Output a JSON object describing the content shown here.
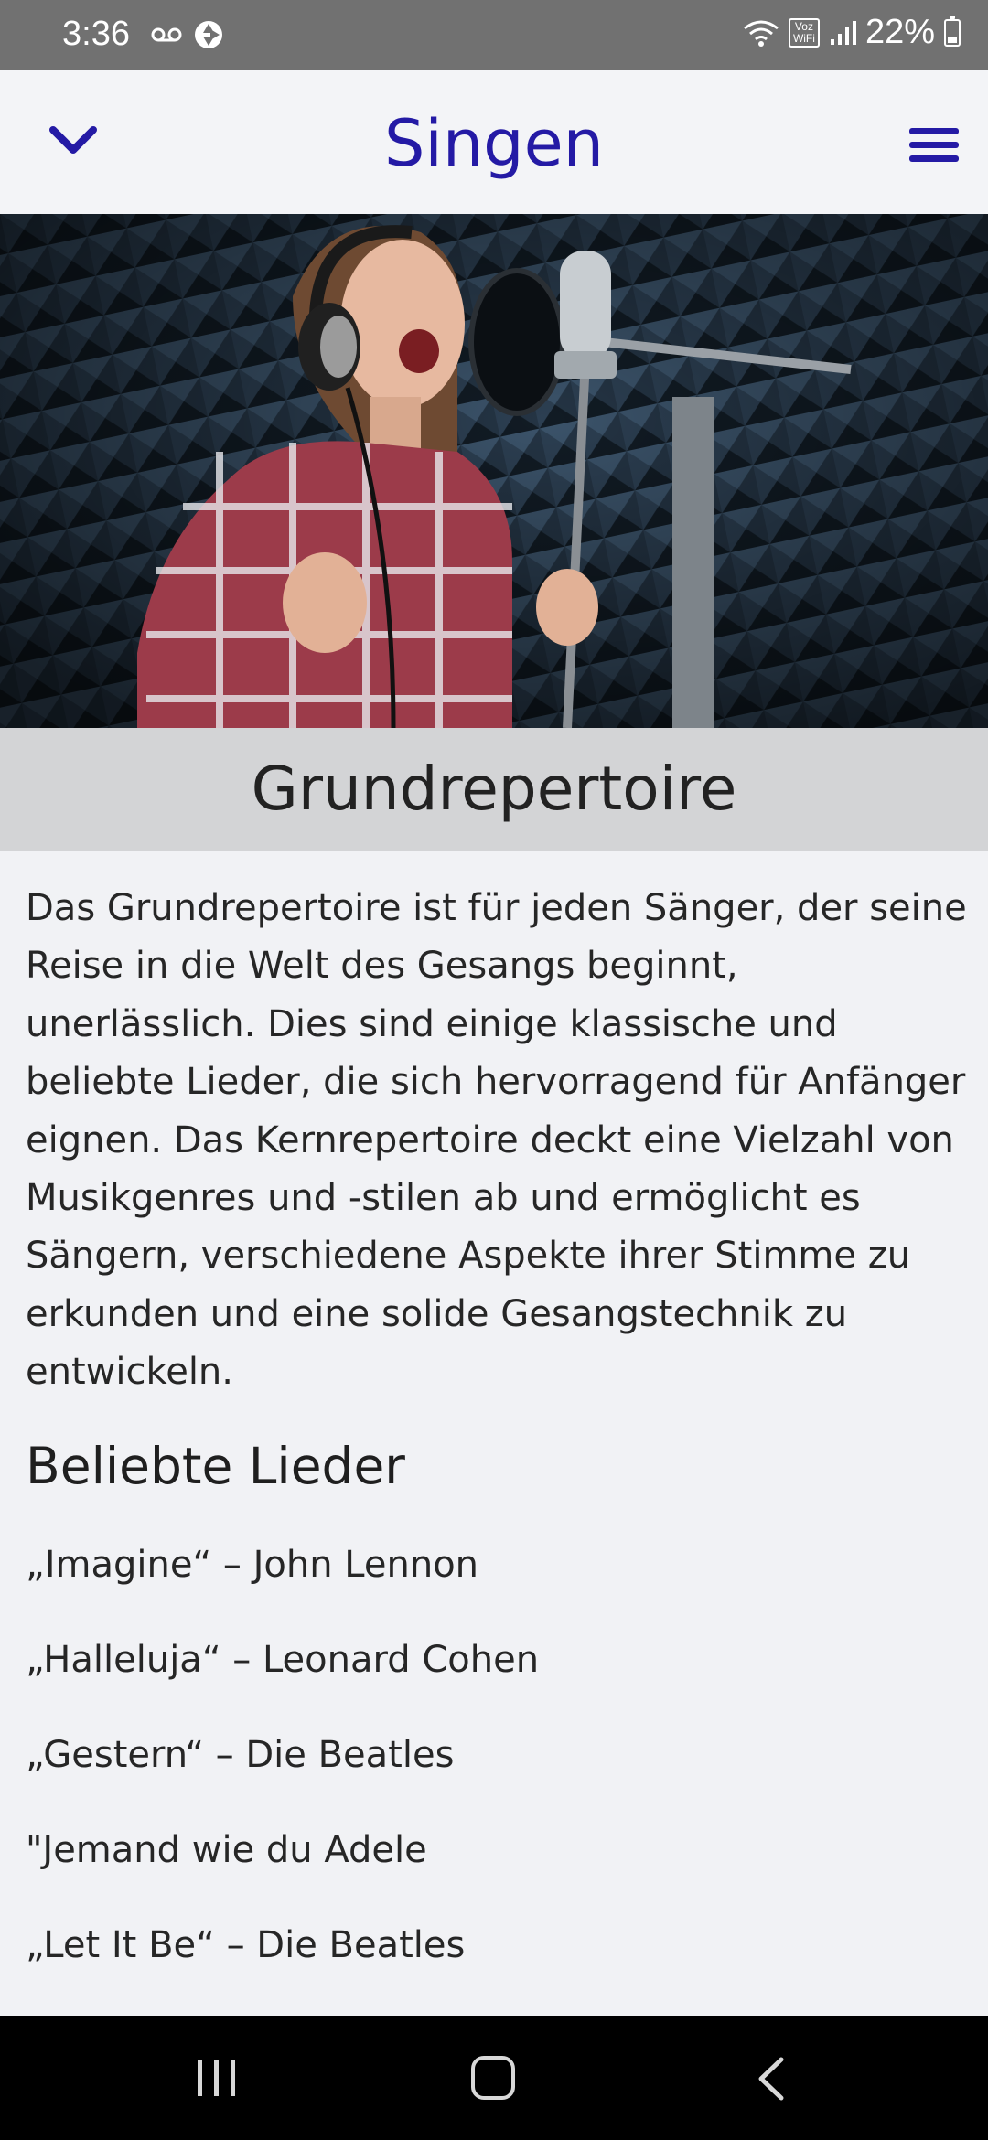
{
  "status_bar": {
    "time": "3:36",
    "battery": "22%",
    "vowifi_top": "Voz",
    "vowifi_bottom": "WiFi",
    "battery_level": 0.22
  },
  "app_bar": {
    "title": "Singen",
    "title_color": "#241aa5"
  },
  "section": {
    "title": "Grundrepertoire",
    "intro": "Das Grundrepertoire ist für jeden Sänger, der seine Reise in die Welt des Gesangs beginnt, unerlässlich. Dies sind einige klassische und beliebte Lieder, die sich hervorragend für Anfänger eignen. Das Kernrepertoire deckt eine Vielzahl von Musikgenres und -stilen ab und ermöglicht es Sängern, verschiedene Aspekte ihrer Stimme zu erkunden und eine solide Gesangstechnik zu entwickeln.",
    "songs_heading": "Beliebte Lieder",
    "songs": [
      "„Imagine“ – John Lennon",
      "„Halleluja“ – Leonard Cohen",
      "„Gestern“ – Die Beatles",
      "\"Jemand wie du Adele",
      "„Let It Be“ – Die Beatles"
    ]
  },
  "icons": {
    "back": "chevron-down-icon",
    "menu": "hamburger-menu-icon",
    "nav_recent": "recent-apps-icon",
    "nav_home": "home-icon",
    "nav_back": "back-arrow-icon"
  }
}
